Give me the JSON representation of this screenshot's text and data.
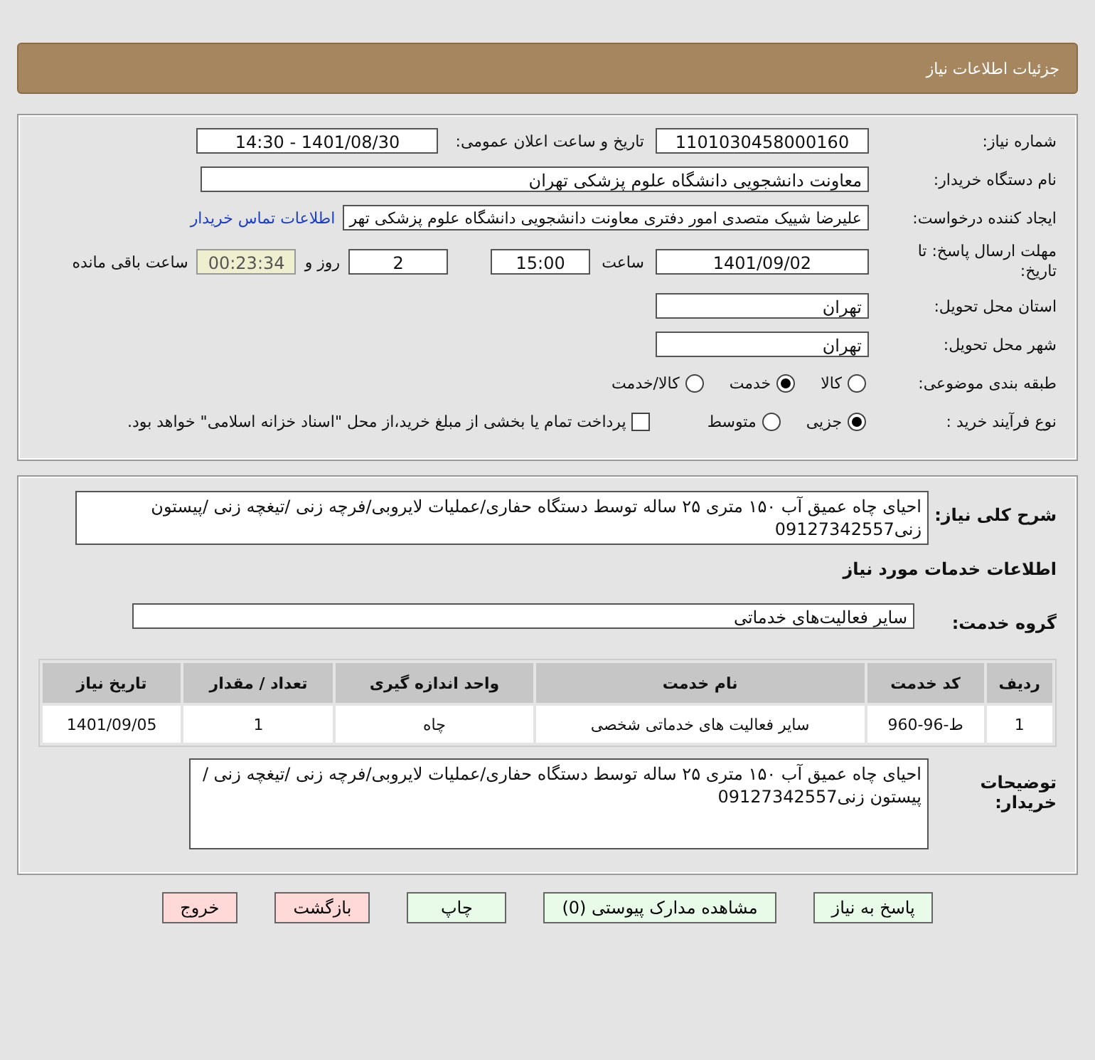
{
  "header": {
    "title": "جزئیات اطلاعات نیاز"
  },
  "details": {
    "need_number": {
      "label": "شماره نیاز:",
      "value": "1101030458000160"
    },
    "announce": {
      "label": "تاریخ و ساعت اعلان عمومی:",
      "value": "1401/08/30 - 14:30"
    },
    "buyer_org": {
      "label": "نام دستگاه خریدار:",
      "value": "معاونت دانشجویی دانشگاه علوم پزشکی تهران"
    },
    "requester": {
      "label": "ایجاد کننده درخواست:",
      "value": "علیرضا شییک متصدی امور دفتری معاونت دانشجویی دانشگاه علوم پزشکی تهر",
      "link": "اطلاعات تماس خریدار"
    },
    "deadline": {
      "label": "مهلت ارسال پاسخ: تا تاریخ:",
      "date": "1401/09/02",
      "time_label": "ساعت",
      "time": "15:00",
      "days": "2",
      "days_label": "روز و",
      "remaining": "00:23:34",
      "remaining_label": "ساعت باقی مانده"
    },
    "province": {
      "label": "استان محل تحویل:",
      "value": "تهران"
    },
    "city": {
      "label": "شهر محل تحویل:",
      "value": "تهران"
    },
    "category": {
      "label": "طبقه بندی موضوعی:",
      "options": [
        {
          "label": "کالا",
          "selected": false
        },
        {
          "label": "خدمت",
          "selected": true
        },
        {
          "label": "کالا/خدمت",
          "selected": false
        }
      ]
    },
    "process": {
      "label": "نوع فرآیند خرید :",
      "options": [
        {
          "label": "جزیی",
          "selected": true
        },
        {
          "label": "متوسط",
          "selected": false
        }
      ],
      "payment": {
        "label": "پرداخت تمام یا بخشی از مبلغ خرید،از محل \"اسناد خزانه اسلامی\" خواهد بود.",
        "checked": false
      }
    }
  },
  "summary": {
    "label": "شرح کلی نیاز:",
    "text": "احیای چاه عمیق آب ۱۵۰ متری ۲۵ ساله توسط دستگاه حفاری/عملیات لایروبی/فرچه زنی /تیغچه زنی /پیستون زنی09127342557"
  },
  "services_heading": "اطلاعات خدمات مورد نیاز",
  "service_group": {
    "label": "گروه خدمت:",
    "value": "سایر فعالیت‌های خدماتی"
  },
  "table": {
    "columns": [
      "ردیف",
      "کد خدمت",
      "نام خدمت",
      "واحد اندازه گیری",
      "تعداد / مقدار",
      "تاریخ نیاز"
    ],
    "rows": [
      [
        "1",
        "ط-96-960",
        "سایر فعالیت های خدماتی شخصی",
        "چاه",
        "1",
        "1401/09/05"
      ]
    ]
  },
  "buyer_notes": {
    "label": "توضیحات خریدار:",
    "text": "احیای چاه عمیق آب ۱۵۰ متری ۲۵ ساله توسط دستگاه حفاری/عملیات لایروبی/فرچه زنی /تیغچه زنی /پیستون زنی09127342557"
  },
  "buttons": [
    {
      "label": "پاسخ به نیاز",
      "kind": "green"
    },
    {
      "label": "مشاهده مدارک پیوستی (0)",
      "kind": "green"
    },
    {
      "label": "چاپ",
      "kind": "green"
    },
    {
      "label": "بازگشت",
      "kind": "pink"
    },
    {
      "label": "خروج",
      "kind": "pink"
    }
  ]
}
